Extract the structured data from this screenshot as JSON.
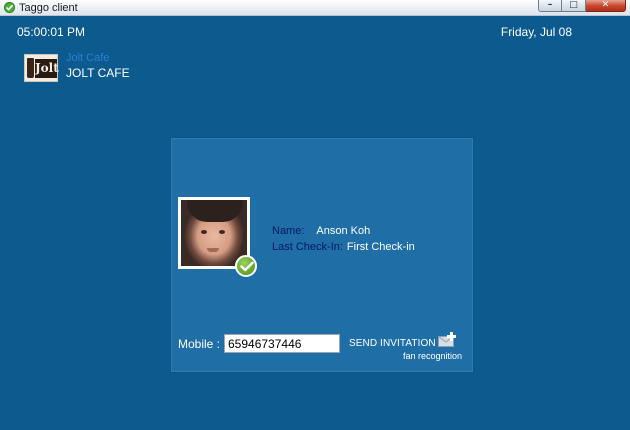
{
  "window": {
    "title": "Taggo client",
    "minimize_glyph": "–",
    "maximize_glyph": "□",
    "close_glyph": "✕"
  },
  "header": {
    "time": "05:00:01 PM",
    "date": "Friday, Jul 08",
    "merchant_tag": "Jolt Cafe",
    "merchant_name": "JOLT CAFE",
    "logo_text": "Jolt"
  },
  "member": {
    "name_label": "Name:",
    "name_value": "Anson Koh",
    "checkin_label": "Last Check-In:",
    "checkin_value": "First Check-in"
  },
  "invite": {
    "mobile_label": "Mobile  :",
    "mobile_value": "65946737446",
    "send_label": "SEND INVITATION",
    "sub_label": "fan recognition"
  },
  "colors": {
    "background": "#0d5a8e",
    "card": "#1f6fa6",
    "label_dark": "#07176b",
    "merchant_tag": "#2a7ed8",
    "check_green": "#5fa22a"
  }
}
